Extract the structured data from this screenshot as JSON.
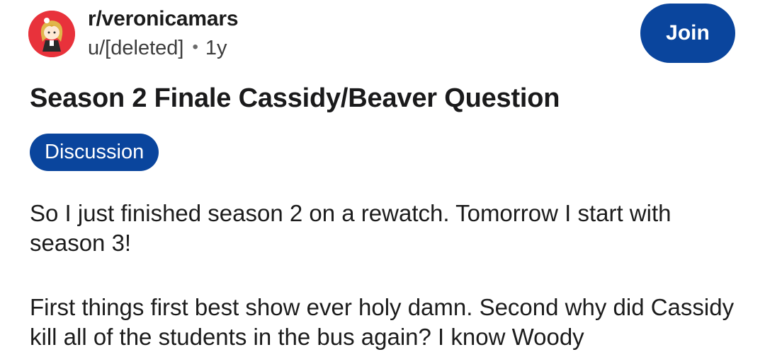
{
  "header": {
    "subreddit": "r/veronicamars",
    "author": "u/[deleted]",
    "separator": "•",
    "age": "1y",
    "join_label": "Join",
    "avatar_icon": "subreddit-avatar-icon"
  },
  "post": {
    "title": "Season 2 Finale Cassidy/Beaver Question",
    "flair": "Discussion",
    "paragraphs": [
      "So I just finished season 2 on a rewatch. Tomorrow I start with season 3!",
      "First things first best show ever holy damn. Second why did Cassidy kill all of the students in the bus again? I know Woody"
    ]
  },
  "colors": {
    "accent": "#0a459d",
    "avatar_bg": "#e8323b",
    "text": "#1c1c1c"
  }
}
